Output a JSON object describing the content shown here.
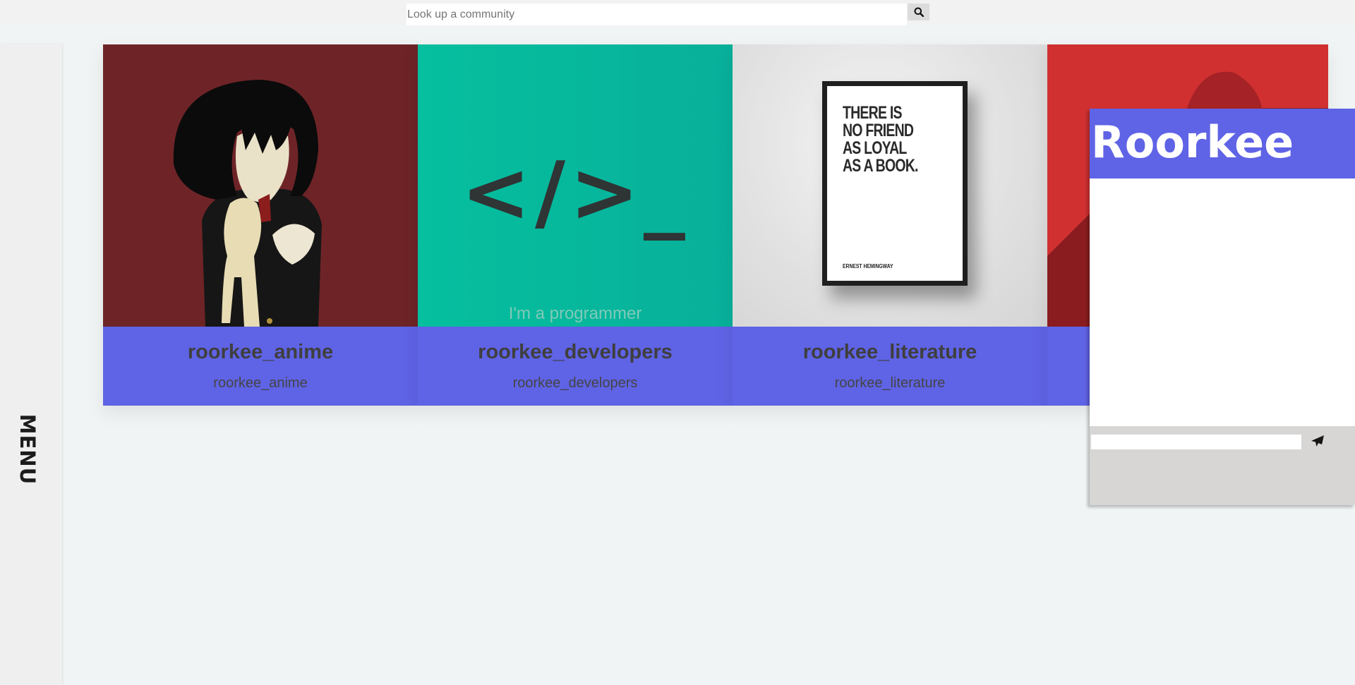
{
  "search": {
    "placeholder": "Look up a community",
    "button_icon": "search-icon"
  },
  "side_menu": {
    "label": "MENU"
  },
  "cards": [
    {
      "title": "roorkee_anime",
      "subtitle": "roorkee_anime",
      "image": "anime-girl-illustration"
    },
    {
      "title": "roorkee_developers",
      "subtitle": "roorkee_developers",
      "image_glyph": "</>_",
      "image_caption": "I'm a programmer"
    },
    {
      "title": "roorkee_literature",
      "subtitle": "roorkee_literature",
      "poster_text": "THERE IS\nNO FRIEND\nAS LOYAL\nAS A BOOK.",
      "poster_author": "ERNEST HEMINGWAY"
    },
    {
      "title": "",
      "subtitle": "",
      "image": "red-abstract"
    }
  ],
  "chat": {
    "title": "Roorkee",
    "input_value": "",
    "send_icon": "send-icon"
  },
  "colors": {
    "accent": "#5f63e5",
    "page_bg": "#f0f4f4",
    "anime_bg": "#6e2427",
    "dev_bg": "#05bf9e",
    "red_card_bg": "#d03030",
    "chat_footer": "#d8d5d5"
  }
}
